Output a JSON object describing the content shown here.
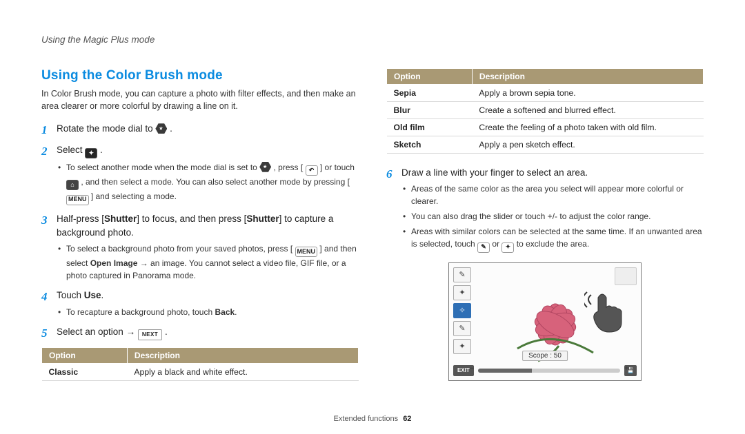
{
  "running_head": "Using the Magic Plus mode",
  "section_title": "Using the Color Brush mode",
  "intro": "In Color Brush mode, you can capture a photo with filter effects, and then make an area clearer or more colorful by drawing a line on it.",
  "steps_left": {
    "s1_pre": "Rotate the mode dial to ",
    "s1_post": ".",
    "s2_pre": "Select ",
    "s2_post": ".",
    "s2_sub1_a": "To select another mode when the mode dial is set to ",
    "s2_sub1_b": ", press [",
    "s2_sub1_c": "] or touch ",
    "s2_sub1_d": ", and then select a mode. You can also select another mode by pressing [",
    "s2_sub1_e": "] and selecting a mode.",
    "s3_a": "Half-press [",
    "s3_b": "Shutter",
    "s3_c": "] to focus, and then press [",
    "s3_d": "Shutter",
    "s3_e": "] to capture a background photo.",
    "s3_sub1_a": "To select a background photo from your saved photos, press [",
    "s3_sub1_b": "] and then select ",
    "s3_sub1_c": "Open Image",
    "s3_sub1_d": " → an image. You cannot select a video file, GIF file, or a photo captured in Panorama mode.",
    "s4_a": "Touch ",
    "s4_b": "Use",
    "s4_c": ".",
    "s4_sub1_a": "To recapture a background photo, touch ",
    "s4_sub1_b": "Back",
    "s4_sub1_c": ".",
    "s5_a": "Select an option → ",
    "s5_b": "."
  },
  "icons": {
    "menu_label": "MENU",
    "next_label": "NEXT"
  },
  "table_left": {
    "headers": [
      "Option",
      "Description"
    ],
    "rows": [
      {
        "opt": "Classic",
        "desc": "Apply a black and white effect."
      }
    ]
  },
  "table_right": {
    "headers": [
      "Option",
      "Description"
    ],
    "rows": [
      {
        "opt": "Sepia",
        "desc": "Apply a brown sepia tone."
      },
      {
        "opt": "Blur",
        "desc": "Create a softened and blurred effect."
      },
      {
        "opt": "Old film",
        "desc": "Create the feeling of a photo taken with old film."
      },
      {
        "opt": "Sketch",
        "desc": "Apply a pen sketch effect."
      }
    ]
  },
  "step6": {
    "text": "Draw a line with your finger to select an area.",
    "subs": [
      "Areas of the same color as the area you select will appear more colorful or clearer.",
      "You can also drag the slider or touch +/- to adjust the color range.",
      {
        "a": "Areas with similar colors can be selected at the same time. If an unwanted area is selected, touch ",
        "b": " or ",
        "c": " to exclude the area."
      }
    ]
  },
  "screen": {
    "scope_label": "Scope : 50",
    "exit": "EXIT"
  },
  "footer": {
    "section": "Extended functions",
    "page": "62"
  }
}
